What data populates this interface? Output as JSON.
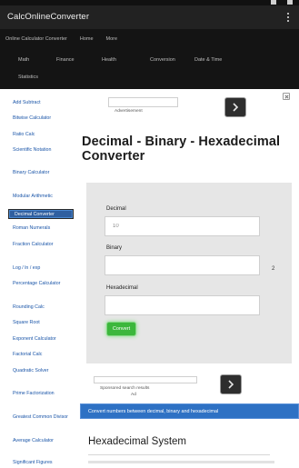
{
  "app": {
    "title": "CalcOnlineConverter"
  },
  "header": {
    "brand": "Online Calculator Converter",
    "menu_home": "Home",
    "menu_more": "More",
    "nav": [
      "Math",
      "Finance",
      "Health",
      "Conversion",
      "Date & Time",
      "Statistics"
    ]
  },
  "sidebar": {
    "items": [
      "Add Subtract",
      "Bitwise Calculator",
      "Ratio Calc",
      "Scientific Notation",
      "Binary Calculator",
      "Modular Arithmetic",
      "Decimal Converter",
      "Roman Numerals",
      "Fraction Calculator",
      "Log / ln / exp",
      "Percentage Calculator",
      "Rounding Calc",
      "Square Root",
      "Exponent Calculator",
      "Factorial Calc",
      "Quadratic Solver",
      "Prime Factorization",
      "Greatest Common Divisor",
      "Average Calculator",
      "Significant Figures"
    ],
    "active_index": 6
  },
  "ads": {
    "top_link": "Advertisement",
    "mid_link": "Sponsored search results",
    "mid_link2": "Ad"
  },
  "page": {
    "title": "Decimal - Binary - Hexadecimal Converter"
  },
  "converter": {
    "decimal_label": "Decimal",
    "decimal_placeholder": "10",
    "binary_label": "Binary",
    "binary_suffix": "2",
    "hex_label": "Hexadecimal",
    "button_label": "Convert"
  },
  "info_bar": {
    "text": "Convert numbers between decimal, binary and hexadecimal"
  },
  "section": {
    "heading": "Hexadecimal System"
  }
}
